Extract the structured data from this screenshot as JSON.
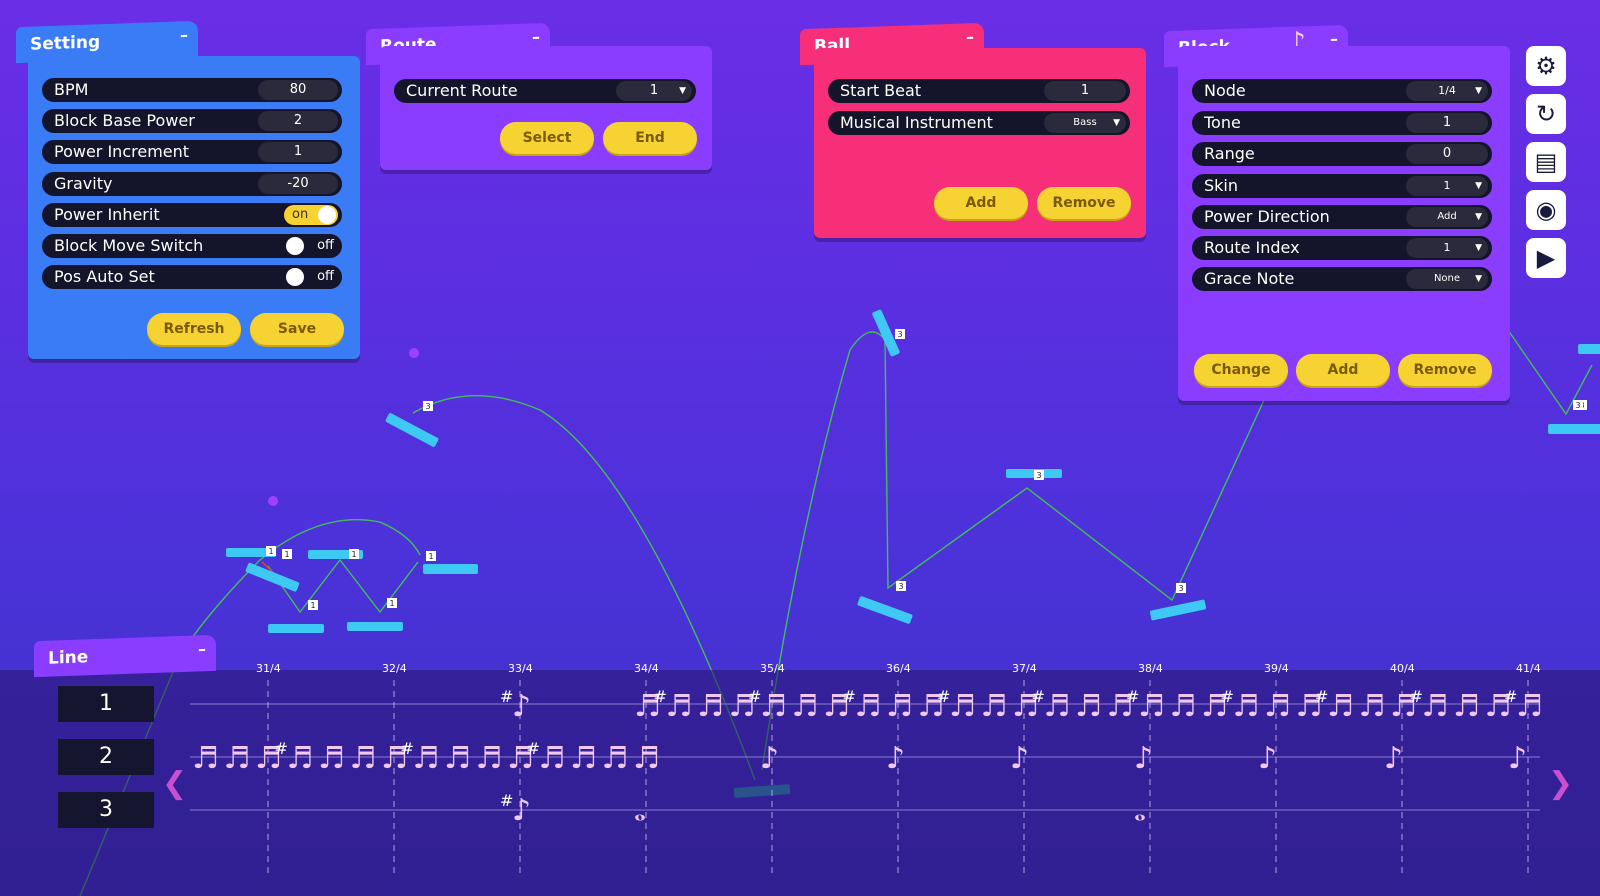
{
  "setting": {
    "title": "Setting",
    "minimize": "–",
    "rows": [
      {
        "label": "BPM",
        "value": "80"
      },
      {
        "label": "Block Base Power",
        "value": "2"
      },
      {
        "label": "Power Increment",
        "value": "1"
      },
      {
        "label": "Gravity",
        "value": "-20"
      }
    ],
    "toggles": [
      {
        "label": "Power Inherit",
        "state": "on"
      },
      {
        "label": "Block Move Switch",
        "state": "off"
      },
      {
        "label": "Pos Auto Set",
        "state": "off"
      }
    ],
    "refresh_label": "Refresh",
    "save_label": "Save"
  },
  "route": {
    "title": "Route",
    "minimize": "–",
    "current_route_label": "Current Route",
    "current_route_value": "1",
    "select_label": "Select",
    "end_label": "End"
  },
  "ball": {
    "title": "Ball",
    "minimize": "–",
    "start_beat_label": "Start Beat",
    "start_beat_value": "1",
    "instrument_label": "Musical Instrument",
    "instrument_value": "Bass",
    "add_label": "Add",
    "remove_label": "Remove"
  },
  "block": {
    "title": "Block",
    "minimize": "–",
    "note_icon": "♪",
    "rows": [
      {
        "label": "Node",
        "value": "1/4",
        "dropdown": true
      },
      {
        "label": "Tone",
        "value": "1",
        "dropdown": false
      },
      {
        "label": "Range",
        "value": "0",
        "dropdown": false
      },
      {
        "label": "Skin",
        "value": "1",
        "dropdown": true
      },
      {
        "label": "Power Direction",
        "value": "Add",
        "dropdown": true
      },
      {
        "label": "Route Index",
        "value": "1",
        "dropdown": true
      },
      {
        "label": "Grace Note",
        "value": "None",
        "dropdown": true
      }
    ],
    "change_label": "Change",
    "add_label": "Add",
    "remove_label": "Remove"
  },
  "toolbar": {
    "icons": [
      "gear-icon",
      "refresh-icon",
      "save-icon",
      "record-icon",
      "play-icon"
    ],
    "glyphs": [
      "⚙",
      "↻",
      "▤",
      "◉",
      "▶"
    ]
  },
  "line": {
    "title": "Line",
    "minimize": "–",
    "lanes": [
      "1",
      "2",
      "3"
    ],
    "beats": [
      "31/4",
      "32/4",
      "33/4",
      "34/4",
      "35/4",
      "36/4",
      "37/4",
      "38/4",
      "39/4",
      "40/4",
      "41/4"
    ],
    "prev_glyph": "❮",
    "next_glyph": "❯"
  },
  "scene": {
    "block_labels": [
      "1",
      "1",
      "1",
      "1",
      "1",
      "1",
      "3",
      "3",
      "3",
      "3",
      "3",
      "3",
      "3"
    ],
    "colors": {
      "block": "#3ec9f5",
      "trajectory": "#3fbf5a",
      "ball": "#a040ff",
      "note": "#f0c8f0"
    }
  }
}
